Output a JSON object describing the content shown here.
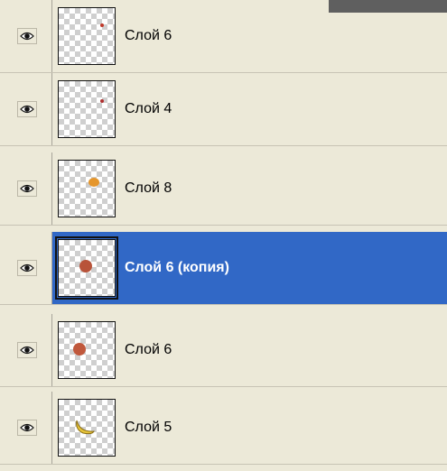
{
  "layers": [
    {
      "name": "Слой 6",
      "visible": true,
      "selected": false,
      "thumbnail": "small-red-dot"
    },
    {
      "name": "Слой 4",
      "visible": true,
      "selected": false,
      "thumbnail": "small-red-dot"
    },
    {
      "name": "Слой 8",
      "visible": true,
      "selected": false,
      "thumbnail": "orange-fruit"
    },
    {
      "name": "Слой 6 (копия)",
      "visible": true,
      "selected": true,
      "thumbnail": "peach"
    },
    {
      "name": "Слой 6",
      "visible": true,
      "selected": false,
      "thumbnail": "peach"
    },
    {
      "name": "Слой 5",
      "visible": true,
      "selected": false,
      "thumbnail": "banana"
    }
  ],
  "colors": {
    "panel_bg": "#ece9d8",
    "selection": "#3168c6",
    "selected_text": "#ffffff"
  },
  "icons": {
    "visibility": "eye-icon"
  }
}
